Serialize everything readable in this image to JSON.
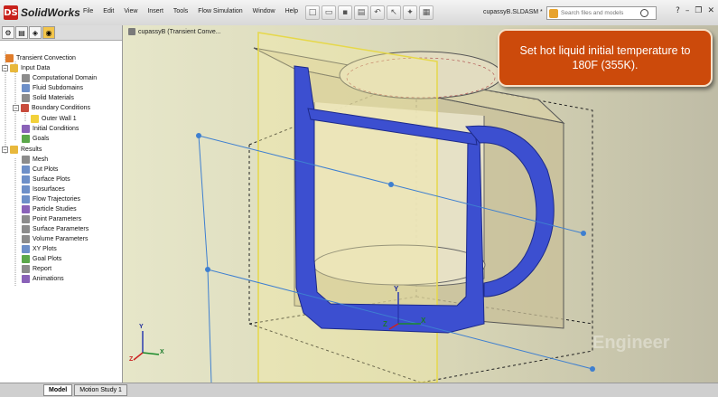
{
  "app": {
    "name": "SolidWorks",
    "logo_glyph": "DS"
  },
  "menu": [
    "File",
    "Edit",
    "View",
    "Insert",
    "Tools",
    "Flow Simulation",
    "Window",
    "Help"
  ],
  "toolbar_icons": [
    "new-icon",
    "open-icon",
    "save-icon",
    "print-icon",
    "undo-icon",
    "select-icon",
    "rebuild-icon",
    "options-icon"
  ],
  "document_title": "cupassyB.SLDASM *",
  "search": {
    "placeholder": "Search files and models"
  },
  "panel_tabs": [
    "feature-manager-icon",
    "property-manager-icon",
    "configuration-icon",
    "flow-analysis-icon"
  ],
  "tree": {
    "root": "Transient Convection",
    "input_data": "Input Data",
    "items_input": [
      "Computational Domain",
      "Fluid Subdomains",
      "Solid Materials",
      "Boundary Conditions"
    ],
    "boundary_child": "Outer Wall 1",
    "items_input_after": [
      "Initial Conditions",
      "Goals"
    ],
    "results": "Results",
    "items_results": [
      "Mesh",
      "Cut Plots",
      "Surface Plots",
      "Isosurfaces",
      "Flow Trajectories",
      "Particle Studies",
      "Point Parameters",
      "Surface Parameters",
      "Volume Parameters",
      "XY Plots",
      "Goal Plots",
      "Report",
      "Animations"
    ]
  },
  "viewport": {
    "title": "cupassyB  (Transient Conve...",
    "callout": "Set hot liquid initial temperature to 180F (355K).",
    "watermark": "Engineer",
    "triad": {
      "x": "X",
      "y": "Y",
      "z": "Z"
    }
  },
  "bottom_tabs": [
    "Model",
    "Motion Study 1"
  ],
  "colors": {
    "callout": "#cc4a0b",
    "cup_section": "#3c4fd0",
    "plane": "#f5eea0",
    "ds_red": "#c8211b"
  }
}
